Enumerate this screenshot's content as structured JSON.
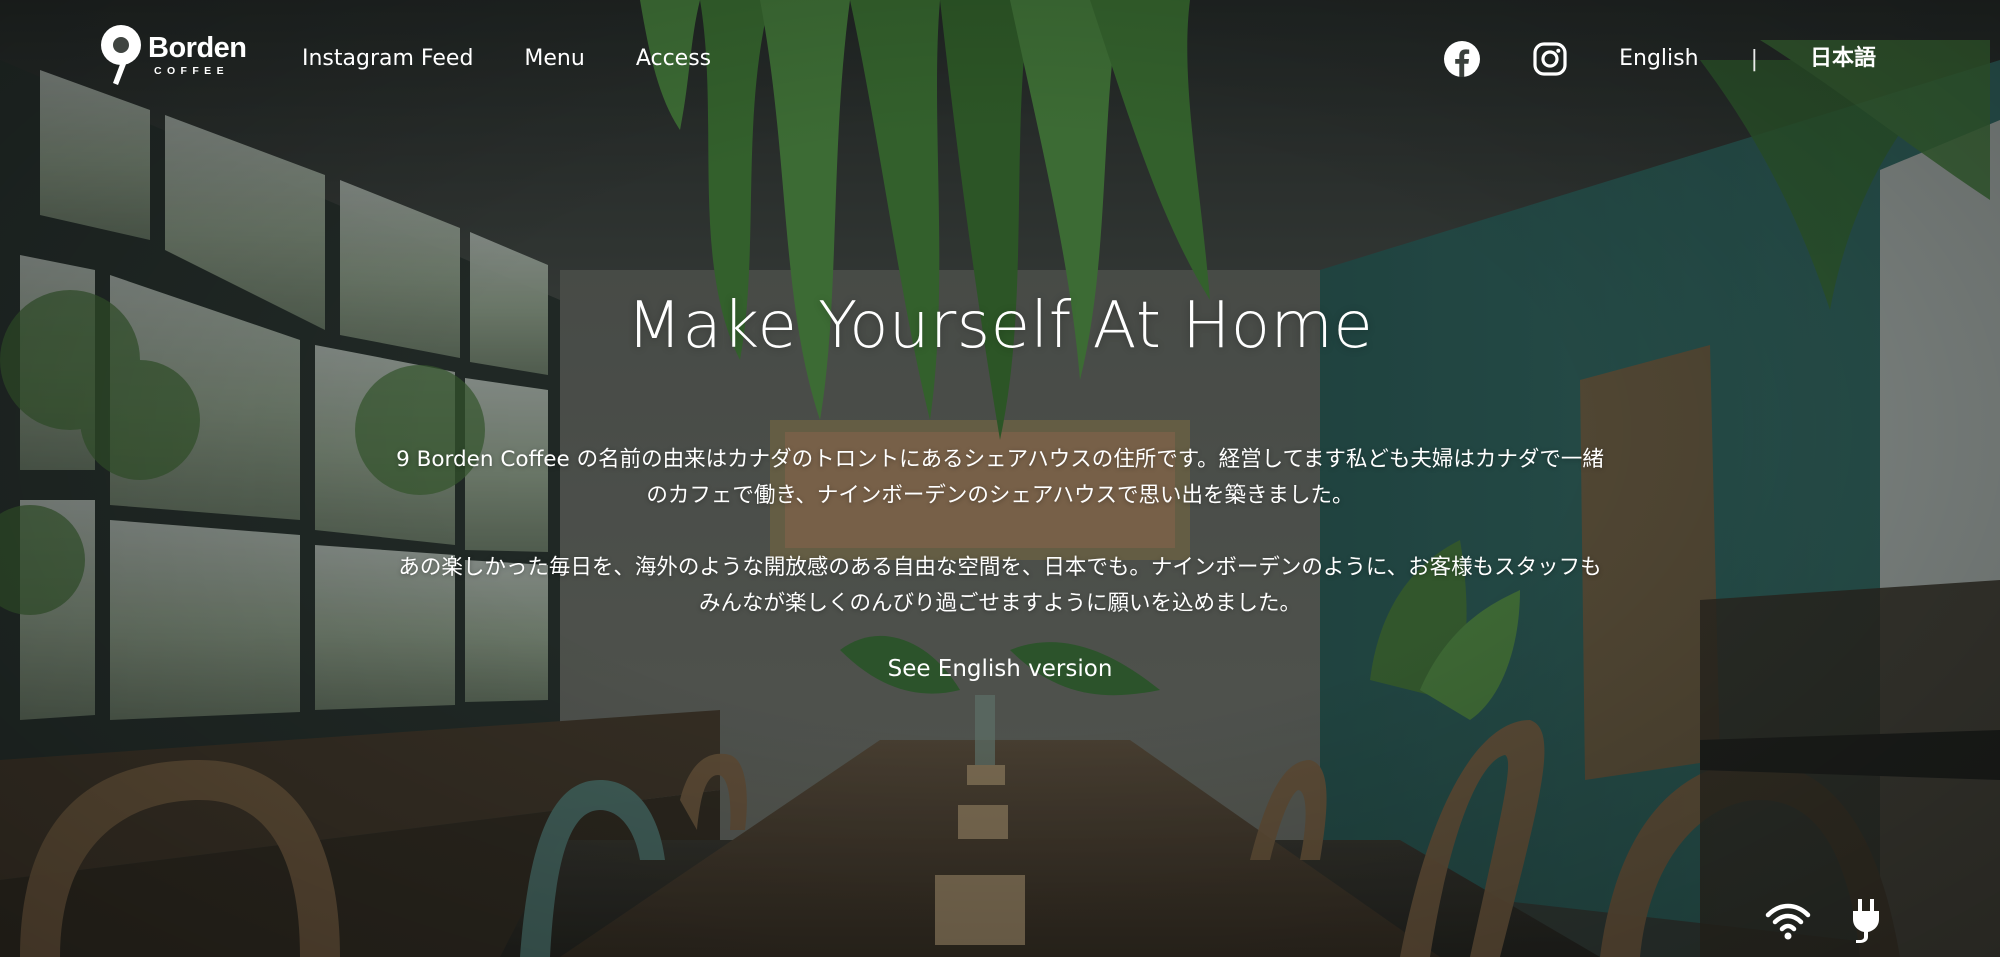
{
  "logo": {
    "word": "Borden",
    "sub": "COFFEE"
  },
  "nav": {
    "links": [
      {
        "label": "Instagram Feed"
      },
      {
        "label": "Menu"
      },
      {
        "label": "Access"
      }
    ],
    "social": [
      {
        "icon": "facebook-icon"
      },
      {
        "icon": "instagram-icon"
      }
    ],
    "languages": {
      "english": "English",
      "separator": "|",
      "japanese": "日本語",
      "active": "japanese"
    }
  },
  "hero": {
    "headline": "Make Yourself At Home",
    "paragraph1": [
      "9 Borden Coffee の名前の由来はカナダのトロントにあるシェアハウスの住所です。経営してます私ども夫婦はカナダで一緒",
      "のカフェで働き、ナインボーデンのシェアハウスで思い出を築きました。"
    ],
    "paragraph2": [
      "あの楽しかった毎日を、海外のような開放感のある自由な空間を、日本でも。ナインボーデンのように、お客様もスタッフも",
      "みんなが楽しくのんびり過ごせますように願いを込めました。"
    ],
    "english_link": "See English version"
  },
  "amenities": [
    {
      "icon": "wifi-icon"
    },
    {
      "icon": "power-plug-icon"
    }
  ],
  "colors": {
    "text": "#ffffff",
    "wall_teal": "#2f6a66",
    "concrete": "#5d605c",
    "wood": "#5a4634",
    "foliage": "#4f8f3f"
  }
}
